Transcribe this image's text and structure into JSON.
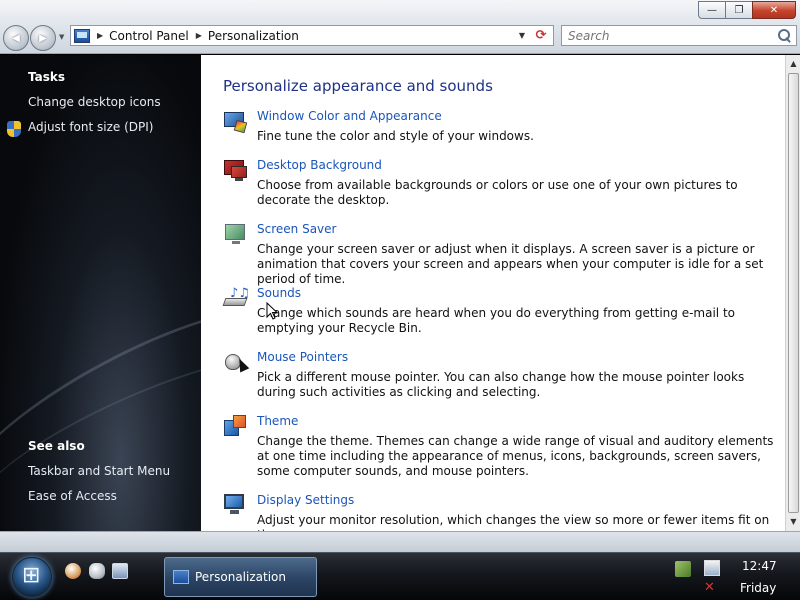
{
  "window": {
    "caption_minimize": "—",
    "caption_maximize": "❐",
    "caption_close": "✕"
  },
  "nav": {
    "back_glyph": "◀",
    "forward_glyph": "▶",
    "dropdown_glyph": "▼"
  },
  "address": {
    "breadcrumbs": [
      "Control Panel",
      "Personalization"
    ],
    "separator": "▶",
    "dropdown_glyph": "▼",
    "refresh_glyph": "⟳"
  },
  "search": {
    "placeholder": "Search"
  },
  "tasks": {
    "heading": "Tasks",
    "links": [
      "Change desktop icons",
      "Adjust font size (DPI)"
    ]
  },
  "see_also": {
    "heading": "See also",
    "links": [
      "Taskbar and Start Menu",
      "Ease of Access"
    ]
  },
  "main": {
    "title": "Personalize appearance and sounds",
    "items": [
      {
        "link": "Window Color and Appearance",
        "desc": "Fine tune the color and style of your windows.",
        "icon": "window-color-icon"
      },
      {
        "link": "Desktop Background",
        "desc": "Choose from available backgrounds or colors or use one of your own pictures to decorate the desktop.",
        "icon": "desktop-background-icon"
      },
      {
        "link": "Screen Saver",
        "desc": "Change your screen saver or adjust when it displays. A screen saver is a picture or animation that covers your screen and appears when your computer is idle for a set period of time.",
        "icon": "screen-saver-icon"
      },
      {
        "link": "Sounds",
        "desc": "Change which sounds are heard when you do everything from getting e-mail to emptying your Recycle Bin.",
        "icon": "sounds-icon"
      },
      {
        "link": "Mouse Pointers",
        "desc": "Pick a different mouse pointer. You can also change how the mouse pointer looks during such activities as clicking and selecting.",
        "icon": "mouse-pointers-icon"
      },
      {
        "link": "Theme",
        "desc": "Change the theme. Themes can change a wide range of visual and auditory elements at one time including the appearance of menus, icons, backgrounds, screen savers, some computer sounds, and mouse pointers.",
        "icon": "theme-icon"
      },
      {
        "link": "Display Settings",
        "desc": "Adjust your monitor resolution, which changes the view so more or fewer items fit on the screen.",
        "icon": "display-settings-icon"
      }
    ]
  },
  "scrollbar": {
    "up_glyph": "▲",
    "down_glyph": "▼"
  },
  "taskbar": {
    "active_window": "Personalization",
    "clock_time": "12:47",
    "clock_day": "Friday"
  },
  "colors": {
    "link": "#1b55b8",
    "title": "#1e3287"
  }
}
